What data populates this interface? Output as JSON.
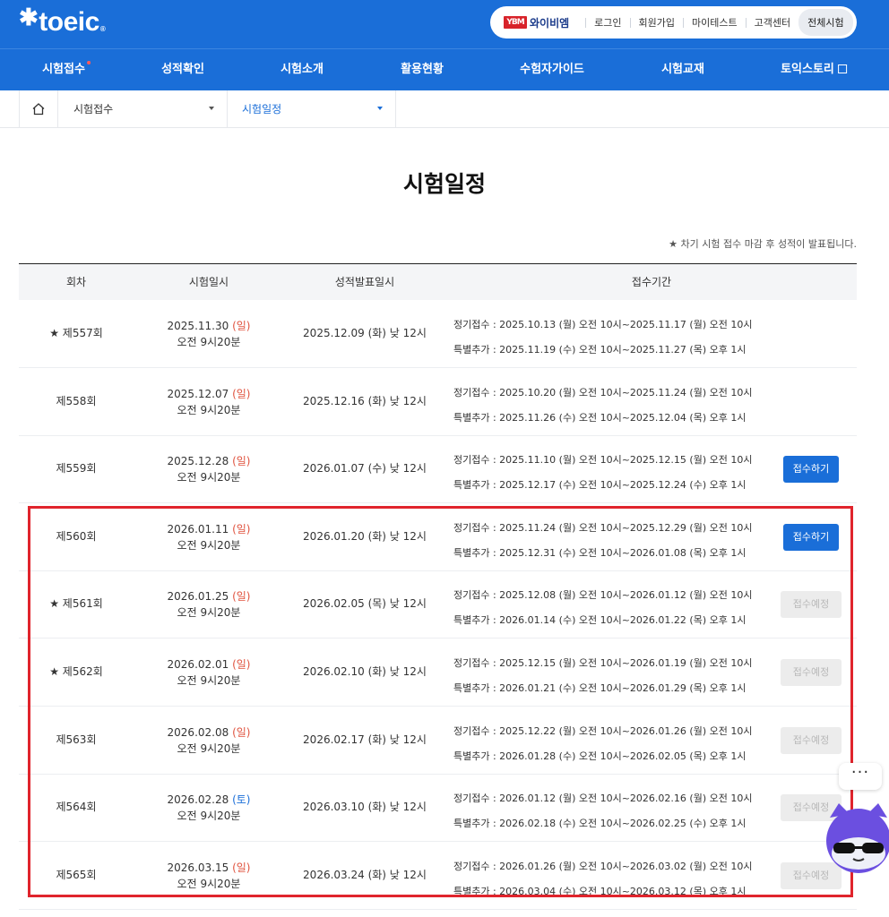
{
  "header": {
    "logo": "toeic",
    "brand": "와이비엠",
    "brand_mark": "YBM",
    "util_links": [
      "로그인",
      "회원가입",
      "마이테스트",
      "고객센터"
    ],
    "all_exams": "전체시험"
  },
  "nav": [
    "시험접수",
    "성적확인",
    "시험소개",
    "활용현황",
    "수험자가이드",
    "시험교재",
    "토익스토리"
  ],
  "breadcrumb": {
    "level1": "시험접수",
    "level2": "시험일정"
  },
  "page_title": "시험일정",
  "note": "★ 차기 시험 접수 마감 후 성적이 발표됩니다.",
  "table": {
    "headers": [
      "회차",
      "시험일시",
      "성적발표일시",
      "접수기간"
    ],
    "rows": [
      {
        "round": "★ 제557회",
        "date": "2025.11.30",
        "day": "(일)",
        "time": "오전 9시20분",
        "result": "2025.12.09 (화) 낮 12시",
        "regular": "정기접수 : 2025.10.13 (월) 오전 10시~2025.11.17 (월) 오전 10시",
        "special": "특별추가 : 2025.11.19 (수) 오전 10시~2025.11.27 (목) 오후 1시",
        "button": ""
      },
      {
        "round": "제558회",
        "date": "2025.12.07",
        "day": "(일)",
        "time": "오전 9시20분",
        "result": "2025.12.16 (화) 낮 12시",
        "regular": "정기접수 : 2025.10.20 (월) 오전 10시~2025.11.24 (월) 오전 10시",
        "special": "특별추가 : 2025.11.26 (수) 오전 10시~2025.12.04 (목) 오후 1시",
        "button": ""
      },
      {
        "round": "제559회",
        "date": "2025.12.28",
        "day": "(일)",
        "time": "오전 9시20분",
        "result": "2026.01.07 (수) 낮 12시",
        "regular": "정기접수 : 2025.11.10 (월) 오전 10시~2025.12.15 (월) 오전 10시",
        "special": "특별추가 : 2025.12.17 (수) 오전 10시~2025.12.24 (수) 오후 1시",
        "button": "접수하기"
      },
      {
        "round": "제560회",
        "date": "2026.01.11",
        "day": "(일)",
        "time": "오전 9시20분",
        "result": "2026.01.20 (화) 낮 12시",
        "regular": "정기접수 : 2025.11.24 (월) 오전 10시~2025.12.29 (월) 오전 10시",
        "special": "특별추가 : 2025.12.31 (수) 오전 10시~2026.01.08 (목) 오후 1시",
        "button": "접수하기"
      },
      {
        "round": "★ 제561회",
        "date": "2026.01.25",
        "day": "(일)",
        "time": "오전 9시20분",
        "result": "2026.02.05 (목) 낮 12시",
        "regular": "정기접수 : 2025.12.08 (월) 오전 10시~2026.01.12 (월) 오전 10시",
        "special": "특별추가 : 2026.01.14 (수) 오전 10시~2026.01.22 (목) 오후 1시",
        "button": "접수예정"
      },
      {
        "round": "★ 제562회",
        "date": "2026.02.01",
        "day": "(일)",
        "time": "오전 9시20분",
        "result": "2026.02.10 (화) 낮 12시",
        "regular": "정기접수 : 2025.12.15 (월) 오전 10시~2026.01.19 (월) 오전 10시",
        "special": "특별추가 : 2026.01.21 (수) 오전 10시~2026.01.29 (목) 오후 1시",
        "button": "접수예정"
      },
      {
        "round": "제563회",
        "date": "2026.02.08",
        "day": "(일)",
        "time": "오전 9시20분",
        "result": "2026.02.17 (화) 낮 12시",
        "regular": "정기접수 : 2025.12.22 (월) 오전 10시~2026.01.26 (월) 오전 10시",
        "special": "특별추가 : 2026.01.28 (수) 오전 10시~2026.02.05 (목) 오후 1시",
        "button": "접수예정"
      },
      {
        "round": "제564회",
        "date": "2026.02.28",
        "day": "(토)",
        "time": "오전 9시20분",
        "result": "2026.03.10 (화) 낮 12시",
        "regular": "정기접수 : 2026.01.12 (월) 오전 10시~2026.02.16 (월) 오전 10시",
        "special": "특별추가 : 2026.02.18 (수) 오전 10시~2026.02.25 (수) 오후 1시",
        "button": "접수예정"
      },
      {
        "round": "제565회",
        "date": "2026.03.15",
        "day": "(일)",
        "time": "오전 9시20분",
        "result": "2026.03.24 (화) 낮 12시",
        "regular": "정기접수 : 2026.01.26 (월) 오전 10시~2026.03.02 (월) 오전 10시",
        "special": "특별추가 : 2026.03.04 (수) 오전 10시~2026.03.12 (목) 오후 1시",
        "button": "접수예정"
      }
    ]
  },
  "chatbot": {
    "menu": "···",
    "icon": "chatbot-cat-icon"
  },
  "colors": {
    "primary": "#1a6ed8",
    "sunday": "#e0533f",
    "saturday": "#1a6ed8",
    "highlight": "#e0242c"
  }
}
